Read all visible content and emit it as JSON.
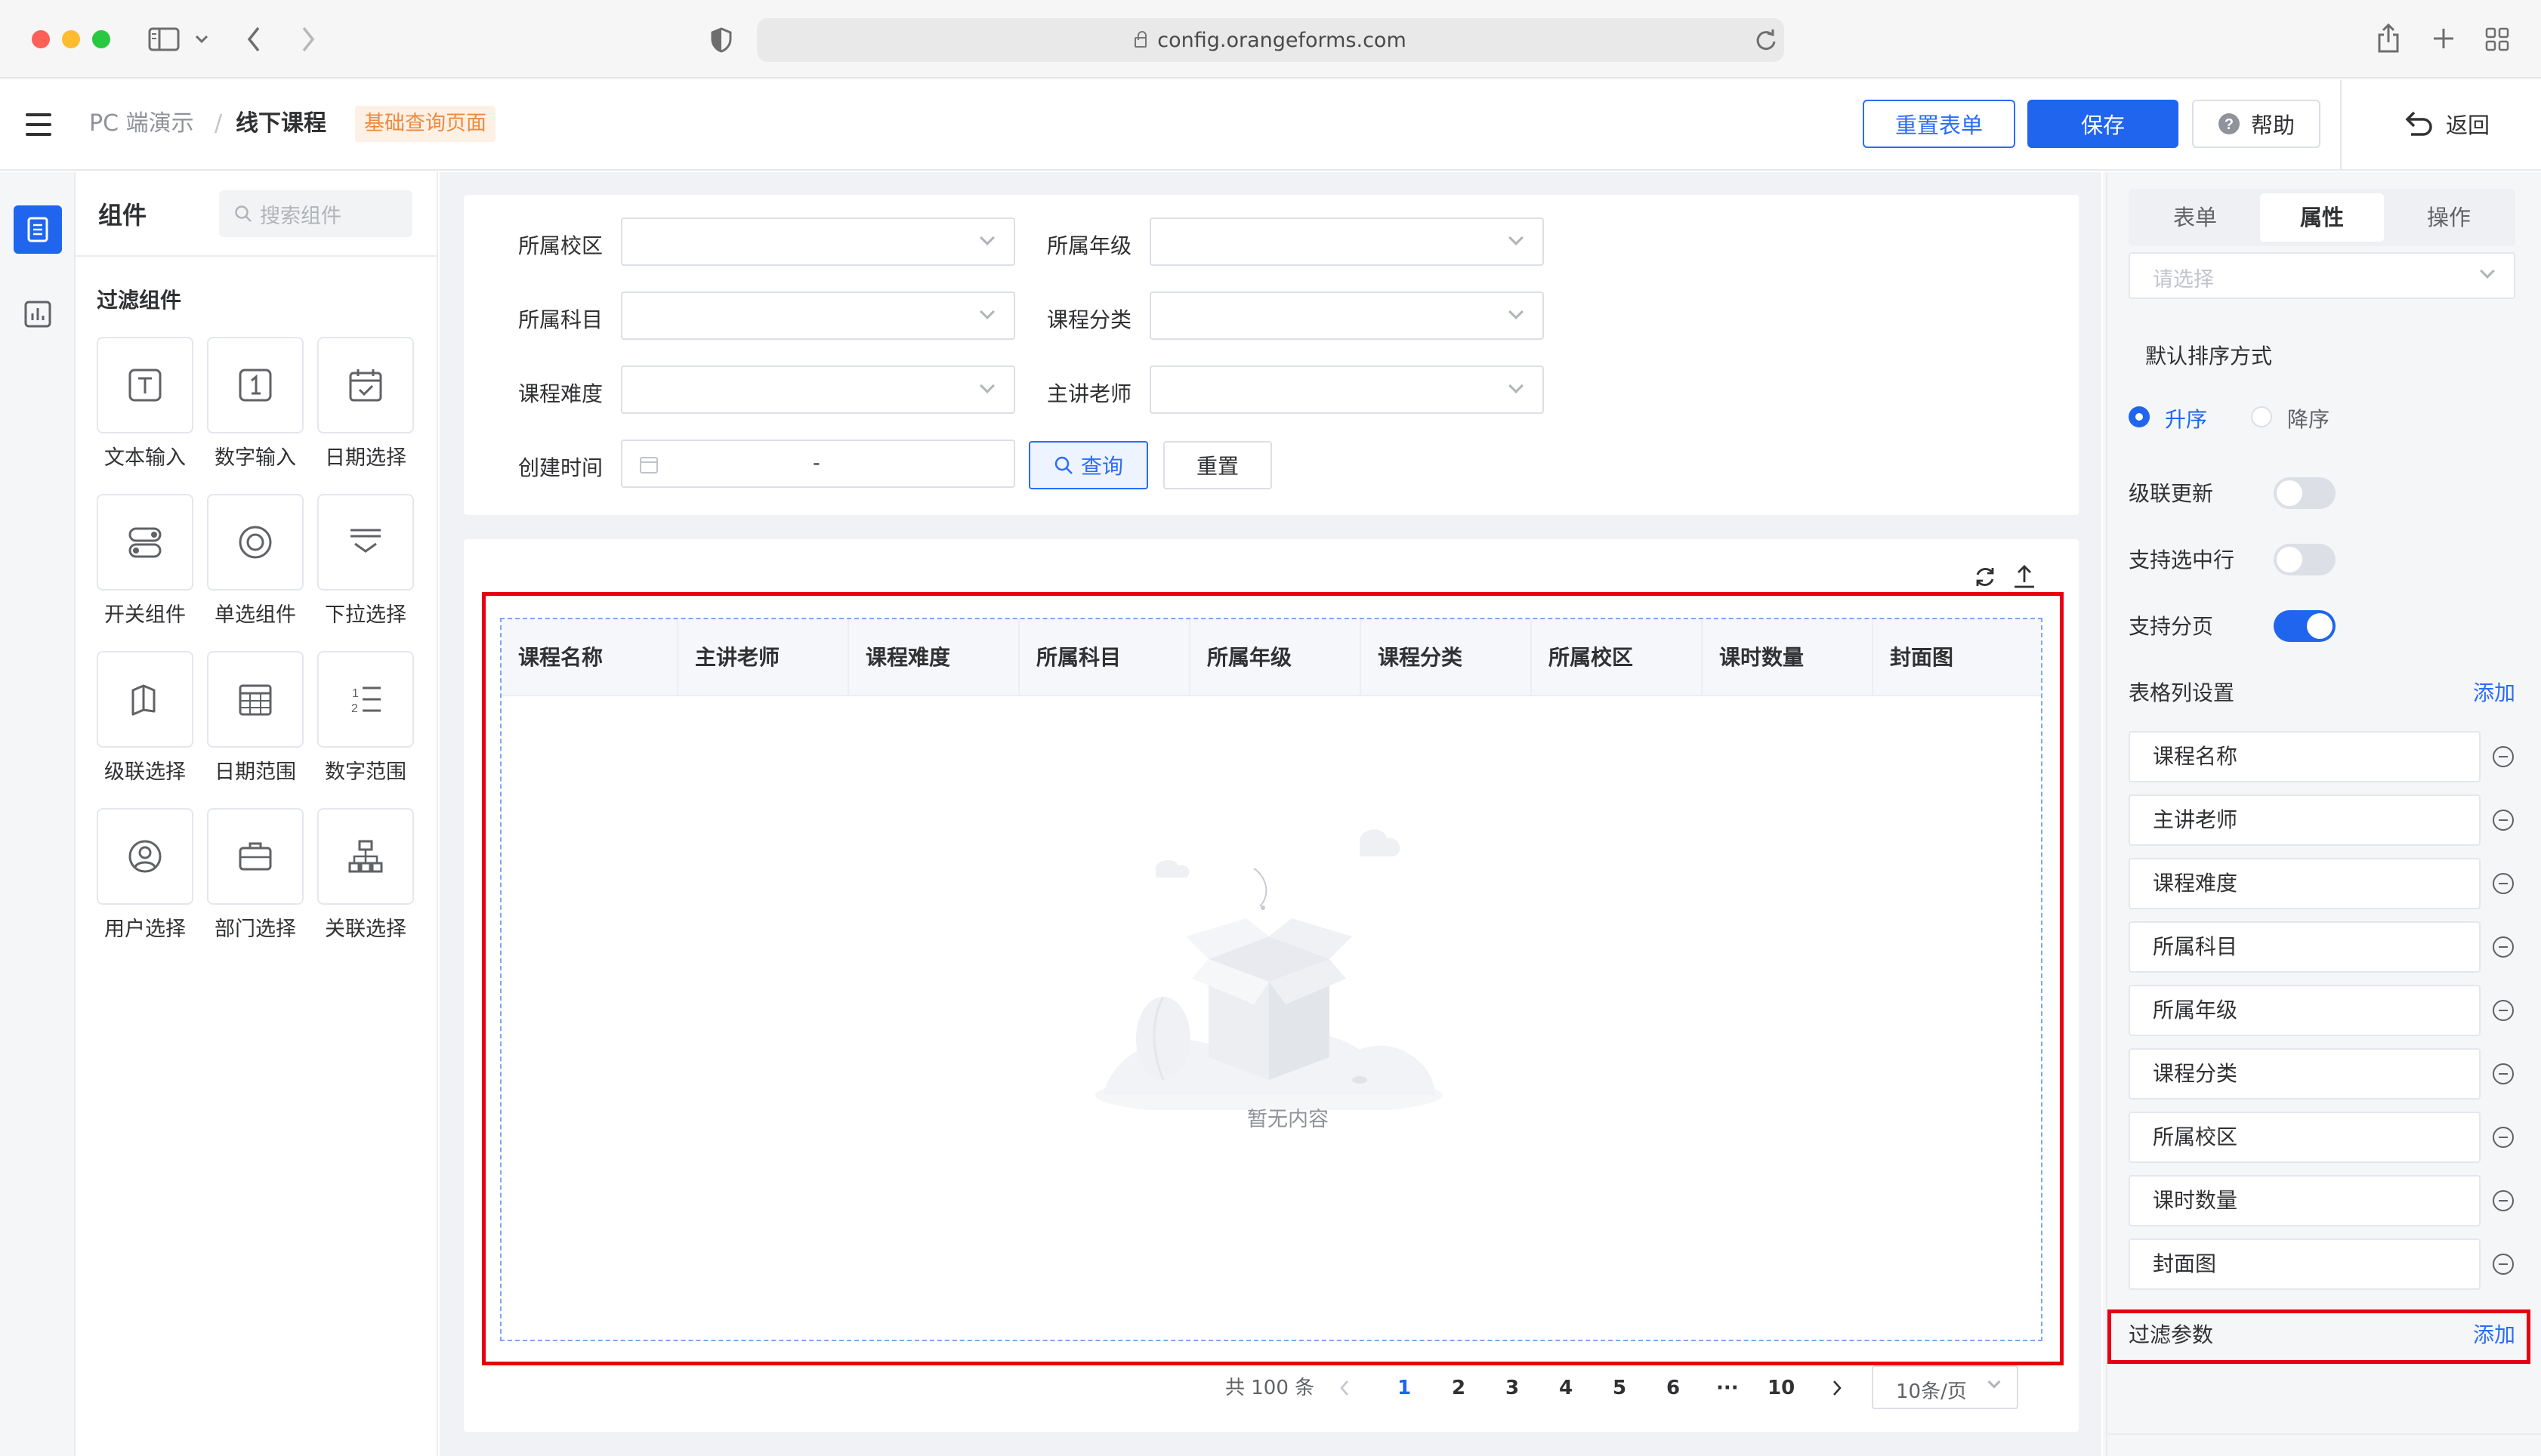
{
  "browser": {
    "url": "config.orangeforms.com"
  },
  "header": {
    "breadcrumb_root": "PC 端演示",
    "breadcrumb_sep": "/",
    "breadcrumb_current": "线下课程",
    "page_tag": "基础查询页面",
    "reset_form_label": "重置表单",
    "save_label": "保存",
    "help_label": "帮助",
    "back_label": "返回"
  },
  "components_panel": {
    "title": "组件",
    "search_placeholder": "搜索组件",
    "section_title": "过滤组件",
    "items": [
      {
        "label": "文本输入",
        "icon": "text-input-icon"
      },
      {
        "label": "数字输入",
        "icon": "number-input-icon"
      },
      {
        "label": "日期选择",
        "icon": "date-picker-icon"
      },
      {
        "label": "开关组件",
        "icon": "switch-icon"
      },
      {
        "label": "单选组件",
        "icon": "radio-icon"
      },
      {
        "label": "下拉选择",
        "icon": "dropdown-icon"
      },
      {
        "label": "级联选择",
        "icon": "cascader-icon"
      },
      {
        "label": "日期范围",
        "icon": "date-range-icon"
      },
      {
        "label": "数字范围",
        "icon": "number-range-icon"
      },
      {
        "label": "用户选择",
        "icon": "user-select-icon"
      },
      {
        "label": "部门选择",
        "icon": "department-select-icon"
      },
      {
        "label": "关联选择",
        "icon": "relation-select-icon"
      }
    ]
  },
  "filter_form": {
    "campus_label": "所属校区",
    "grade_label": "所属年级",
    "subject_label": "所属科目",
    "category_label": "课程分类",
    "difficulty_label": "课程难度",
    "teacher_label": "主讲老师",
    "created_label": "创建时间",
    "date_range_sep": "-",
    "query_label": "查询",
    "reset_label": "重置"
  },
  "table": {
    "columns": [
      "课程名称",
      "主讲老师",
      "课程难度",
      "所属科目",
      "所属年级",
      "课程分类",
      "所属校区",
      "课时数量",
      "封面图"
    ],
    "empty_text": "暂无内容"
  },
  "pagination": {
    "total_text": "共 100 条",
    "pages": [
      "1",
      "2",
      "3",
      "4",
      "5",
      "6"
    ],
    "ellipsis": "···",
    "last_page": "10",
    "current_page": 1,
    "page_size": "10条/页"
  },
  "right_panel": {
    "tabs": [
      "表单",
      "属性",
      "操作"
    ],
    "active_tab": "属性",
    "select_placeholder": "请选择",
    "sort_title": "默认排序方式",
    "sort_asc": "升序",
    "sort_desc": "降序",
    "sort_value": "升序",
    "cascade_update": "级联更新",
    "cascade_update_on": false,
    "select_row": "支持选中行",
    "select_row_on": false,
    "paging": "支持分页",
    "paging_on": true,
    "columns_title": "表格列设置",
    "add_label": "添加",
    "column_items": [
      "课程名称",
      "主讲老师",
      "课程难度",
      "所属科目",
      "所属年级",
      "课程分类",
      "所属校区",
      "课时数量",
      "封面图"
    ],
    "filter_params_title": "过滤参数",
    "filter_add_label": "添加"
  },
  "colors": {
    "primary": "#1f65ed",
    "highlight_red": "#e60012",
    "tag_orange": "#ee8a3d"
  }
}
